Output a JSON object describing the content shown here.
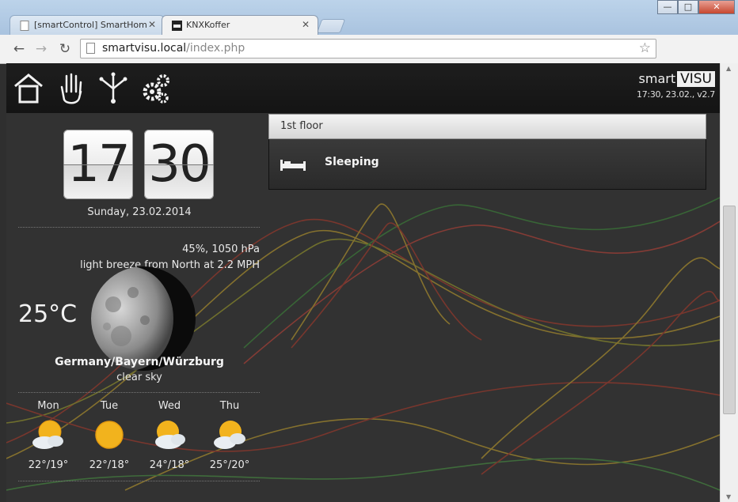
{
  "browser": {
    "tabs": [
      {
        "label": "[smartControl] SmartHom",
        "active": false
      },
      {
        "label": "KNXKoffer",
        "active": true
      }
    ],
    "window_buttons": {
      "minimize": "—",
      "maximize": "□",
      "close": "✕"
    },
    "url": {
      "host": "smartvisu.local",
      "path": "/index.php"
    },
    "extensions": [
      "star-extension",
      "c-extension"
    ]
  },
  "header": {
    "nav": [
      "home-icon",
      "hand-icon",
      "network-icon",
      "gears-icon"
    ],
    "logo_smart": "smart",
    "logo_visu": "VISU",
    "version_line": "17:30, 23.02., v2.7"
  },
  "clock": {
    "hours": "17",
    "minutes": "30",
    "date": "Sunday, 23.02.2014"
  },
  "weather": {
    "humidity_pressure": "45%, 1050 hPa",
    "wind": "light breeze from North at 2.2 MPH",
    "temperature": "25°C",
    "location": "Germany/Bayern/Würzburg",
    "condition": "clear sky",
    "forecast": [
      {
        "day": "Mon",
        "temps": "22°/19°",
        "icon": "sun-cloud-icon"
      },
      {
        "day": "Tue",
        "temps": "22°/18°",
        "icon": "sun-icon"
      },
      {
        "day": "Wed",
        "temps": "24°/18°",
        "icon": "sun-cloud-icon"
      },
      {
        "day": "Thu",
        "temps": "25°/20°",
        "icon": "sun-cloud-icon"
      }
    ]
  },
  "rooms": {
    "floor_title": "1st floor",
    "items": [
      {
        "label": "Sleeping",
        "icon": "bed-icon"
      }
    ]
  }
}
